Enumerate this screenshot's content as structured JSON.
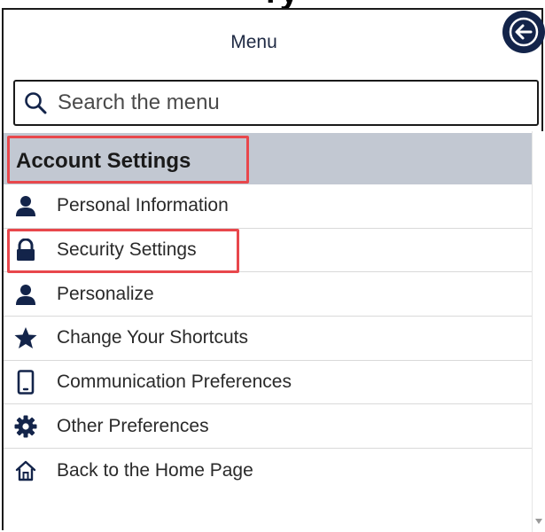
{
  "header": {
    "partial_heading": "ry",
    "title": "Menu",
    "back_label": "Back"
  },
  "search": {
    "placeholder": "Search the menu"
  },
  "section": {
    "title": "Account Settings"
  },
  "items": [
    {
      "label": "Personal Information",
      "icon": "user-icon"
    },
    {
      "label": "Security Settings",
      "icon": "lock-icon"
    },
    {
      "label": "Personalize",
      "icon": "user-icon"
    },
    {
      "label": "Change Your Shortcuts",
      "icon": "star-icon"
    },
    {
      "label": "Communication Preferences",
      "icon": "mobile-phone-icon"
    },
    {
      "label": "Other Preferences",
      "icon": "gear-icon"
    },
    {
      "label": "Back to the Home Page",
      "icon": "home-icon"
    }
  ],
  "colors": {
    "icon": "#13244a",
    "section_bg": "#c2c8d2",
    "highlight": "#e8474c"
  }
}
